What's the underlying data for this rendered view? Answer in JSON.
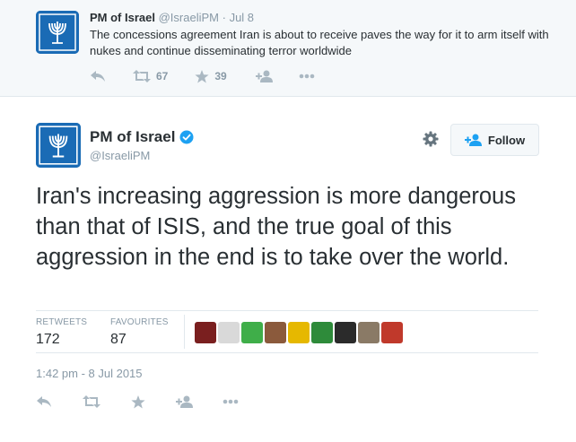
{
  "previous_tweet": {
    "name": "PM of Israel",
    "handle": "@IsraeliPM",
    "separator": "·",
    "date": "Jul 8",
    "text": "The concessions agreement Iran is about to receive paves the way for it to arm itself with nukes and continue disseminating terror worldwide",
    "retweets": "67",
    "favourites": "39"
  },
  "main_tweet": {
    "name": "PM of Israel",
    "handle": "@IsraeliPM",
    "follow_label": "Follow",
    "text": "Iran's increasing aggression is more dangerous than that of ISIS, and the true goal of this aggression in the end is to take over the world.",
    "retweets_label": "RETWEETS",
    "retweets_count": "172",
    "favourites_label": "FAVOURITES",
    "favourites_count": "87",
    "timestamp": "1:42 pm - 8 Jul 2015"
  },
  "colors": {
    "accent": "#1da1f2",
    "avatar": "#1a6bb5",
    "muted": "#8899a6",
    "icon": "#aab8c2"
  },
  "favouriter_colors": [
    "#7a1f1f",
    "#d9d9d9",
    "#3fae49",
    "#8b5a3c",
    "#e6b800",
    "#2e8b3a",
    "#2b2b2b",
    "#8a7a66",
    "#c0392b"
  ]
}
